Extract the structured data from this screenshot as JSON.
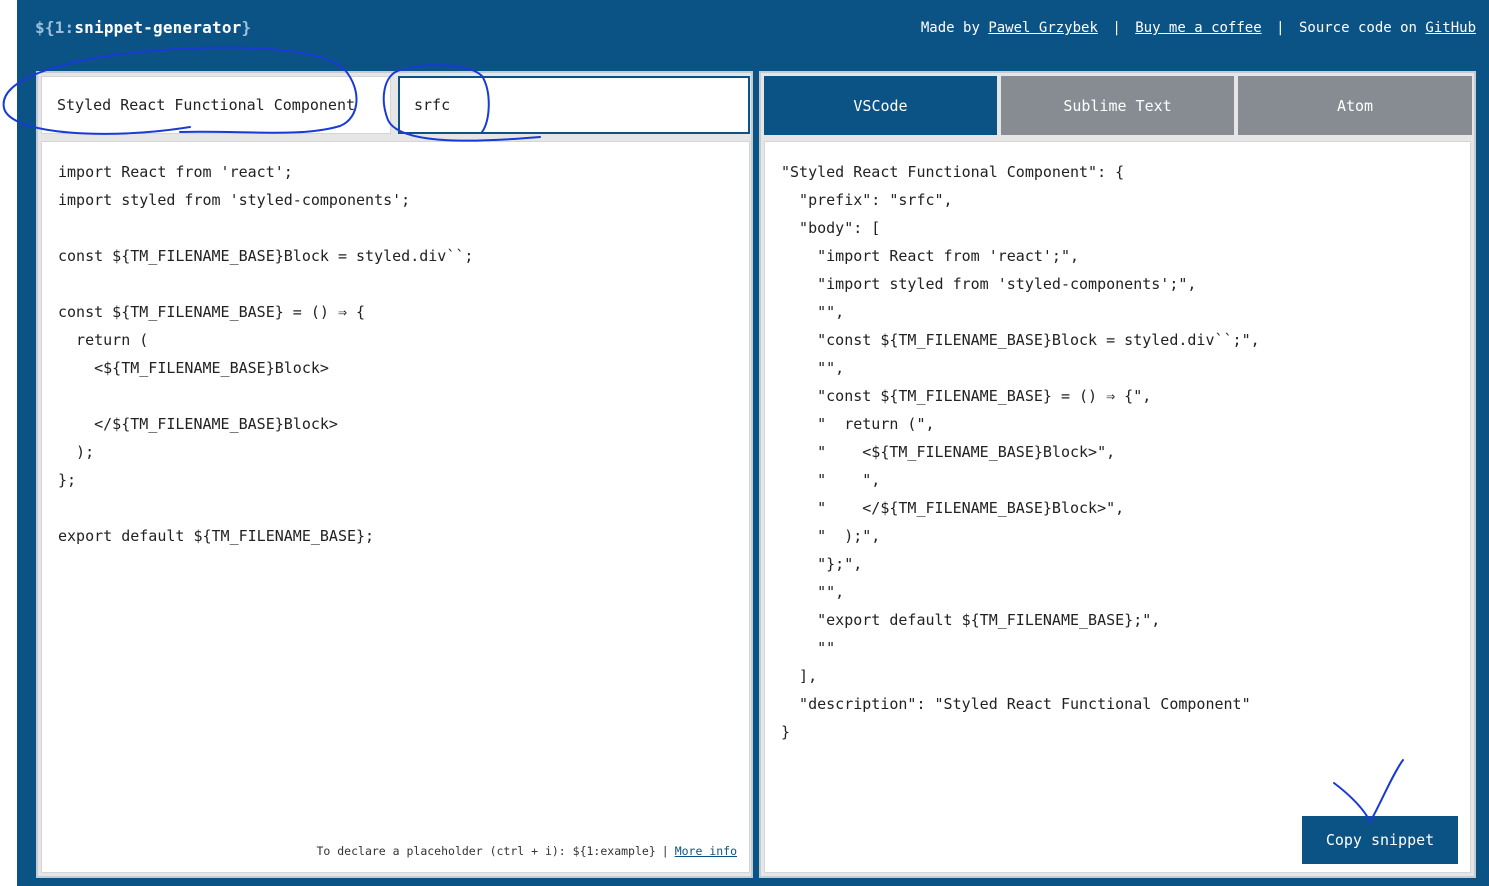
{
  "header": {
    "logo_prefix": "${1:",
    "logo_name": "snippet-generator",
    "logo_suffix": "}",
    "made_by": "Made by",
    "author": "Pawel Grzybek",
    "coffee": "Buy me a coffee",
    "source_text": "Source code on",
    "github": "GitHub"
  },
  "editor": {
    "description_value": "Styled React Functional Component",
    "prefix_value": "srfc",
    "code_lines": [
      "import React from 'react';",
      "import styled from 'styled-components';",
      "",
      "const ${TM_FILENAME_BASE}Block = styled.div``;",
      "",
      "const ${TM_FILENAME_BASE} = () ⇒ {",
      "  return (",
      "    <${TM_FILENAME_BASE}Block>",
      "",
      "    </${TM_FILENAME_BASE}Block>",
      "  );",
      "};",
      "",
      "export default ${TM_FILENAME_BASE};"
    ],
    "hint": "To declare a placeholder (ctrl + i): ${1:example}",
    "hint_link": "More info"
  },
  "output": {
    "tabs": [
      {
        "label": "VSCode",
        "active": true
      },
      {
        "label": "Sublime Text",
        "active": false
      },
      {
        "label": "Atom",
        "active": false
      }
    ],
    "lines": [
      "\"Styled React Functional Component\": {",
      "  \"prefix\": \"srfc\",",
      "  \"body\": [",
      "    \"import React from 'react';\",",
      "    \"import styled from 'styled-components';\",",
      "    \"\",",
      "    \"const ${TM_FILENAME_BASE}Block = styled.div``;\",",
      "    \"\",",
      "    \"const ${TM_FILENAME_BASE} = () ⇒ {\",",
      "    \"  return (\",",
      "    \"    <${TM_FILENAME_BASE}Block>\",",
      "    \"    \",",
      "    \"    </${TM_FILENAME_BASE}Block>\",",
      "    \"  );\",",
      "    \"};\",",
      "    \"\",",
      "    \"export default ${TM_FILENAME_BASE};\",",
      "    \"\"",
      "  ],",
      "  \"description\": \"Styled React Functional Component\"",
      "}"
    ],
    "copy_label": "Copy snippet"
  },
  "colors": {
    "brand": "#0b5385",
    "tab_inactive": "#878c92",
    "annotation_ink": "#1a3ad6"
  }
}
